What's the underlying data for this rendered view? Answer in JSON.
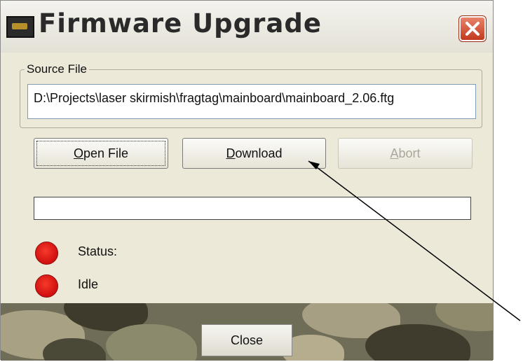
{
  "window": {
    "title": "Firmware Upgrade",
    "icons": {
      "app": "camo-app-icon",
      "close": "close-icon"
    }
  },
  "source_file": {
    "group_label": "Source File",
    "path": "D:\\Projects\\laser skirmish\\fragtag\\mainboard\\mainboard_2.06.ftg"
  },
  "buttons": {
    "open_prefix": "O",
    "open_rest": "pen File",
    "download_prefix": "D",
    "download_rest": "ownload",
    "abort_prefix": "A",
    "abort_rest": "bort",
    "close": "Close"
  },
  "progress": {
    "value": 0
  },
  "status": {
    "label": "Status:",
    "value": "Idle"
  },
  "colors": {
    "led": "#e01b14",
    "dialog_bg": "#ece9d8",
    "close_red": "#c2391d"
  }
}
